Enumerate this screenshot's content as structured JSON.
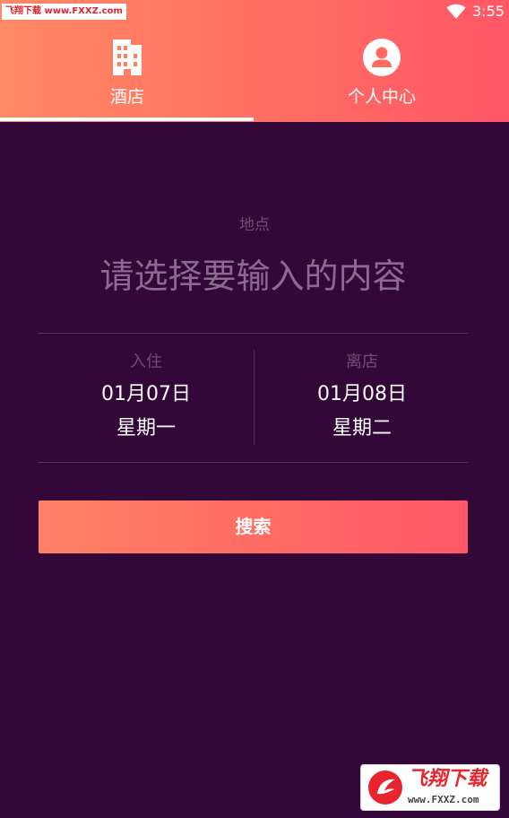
{
  "status_bar": {
    "watermark": "飞翔下载 www.FXXZ.com",
    "time": "3:55",
    "icons": [
      "wifi-icon"
    ]
  },
  "tabs": [
    {
      "label": "酒店",
      "icon": "building-icon",
      "selected": true
    },
    {
      "label": "个人中心",
      "icon": "user-icon",
      "selected": false
    }
  ],
  "search_form": {
    "location_label": "地点",
    "location_placeholder": "请选择要输入的内容",
    "checkin": {
      "label": "入住",
      "date": "01月07日",
      "weekday": "星期一"
    },
    "checkout": {
      "label": "离店",
      "date": "01月08日",
      "weekday": "星期二"
    },
    "search_button": "搜索"
  },
  "watermark_corner": {
    "title": "飞翔下载",
    "url": "www.FXXZ.com"
  },
  "colors": {
    "background": "#330839",
    "accent_start": "#ff8a64",
    "accent_end": "#ff5766",
    "muted_text": "#6f4d72"
  }
}
